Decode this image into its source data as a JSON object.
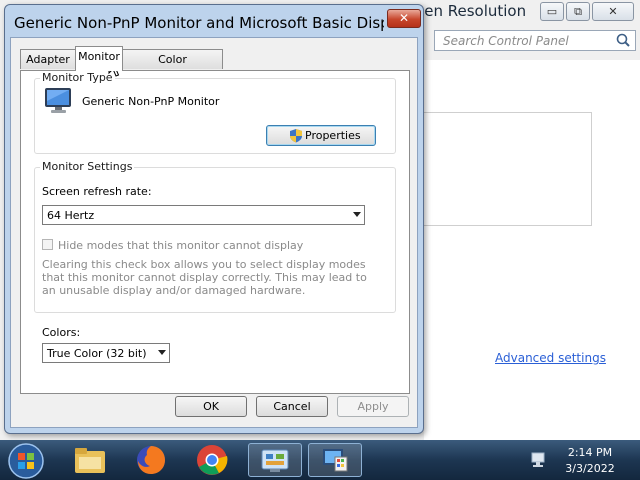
{
  "background_window": {
    "title": "een Resolution",
    "search_placeholder": "Search Control Panel",
    "advanced_settings_link": "Advanced settings",
    "minimize_glyph": "▭",
    "restore_glyph": "⧉",
    "close_glyph": "✕"
  },
  "dialog": {
    "title": "Generic Non-PnP Monitor and Microsoft Basic Display ...",
    "close_glyph": "✕",
    "tabs": [
      {
        "label": "Adapter",
        "active": false
      },
      {
        "label": "Monitor",
        "active": true
      },
      {
        "label": "Color Management",
        "active": false
      }
    ],
    "monitor_type": {
      "group_label": "Monitor Type",
      "monitor_name": "Generic Non-PnP Monitor",
      "properties_button": "Properties"
    },
    "monitor_settings": {
      "group_label": "Monitor Settings",
      "refresh_rate_label": "Screen refresh rate:",
      "refresh_rate_value": "64 Hertz",
      "hide_modes_label": "Hide modes that this monitor cannot display",
      "hide_modes_checked": false,
      "hide_modes_enabled": false,
      "description": "Clearing this check box allows you to select display modes that this monitor cannot display correctly. This may lead to an unusable display and/or damaged hardware."
    },
    "colors": {
      "label": "Colors:",
      "value": "True Color (32 bit)"
    },
    "buttons": {
      "ok": "OK",
      "cancel": "Cancel",
      "apply": "Apply"
    }
  },
  "taskbar": {
    "items": [
      "start-orb",
      "file-explorer",
      "firefox",
      "chrome",
      "control-panel",
      "display-settings"
    ],
    "time": "2:14 PM",
    "date": "3/3/2022"
  },
  "colors": {
    "accent_link": "#2a5fd6",
    "close_red": "#c7462c",
    "taskbar": "#1d3652"
  }
}
